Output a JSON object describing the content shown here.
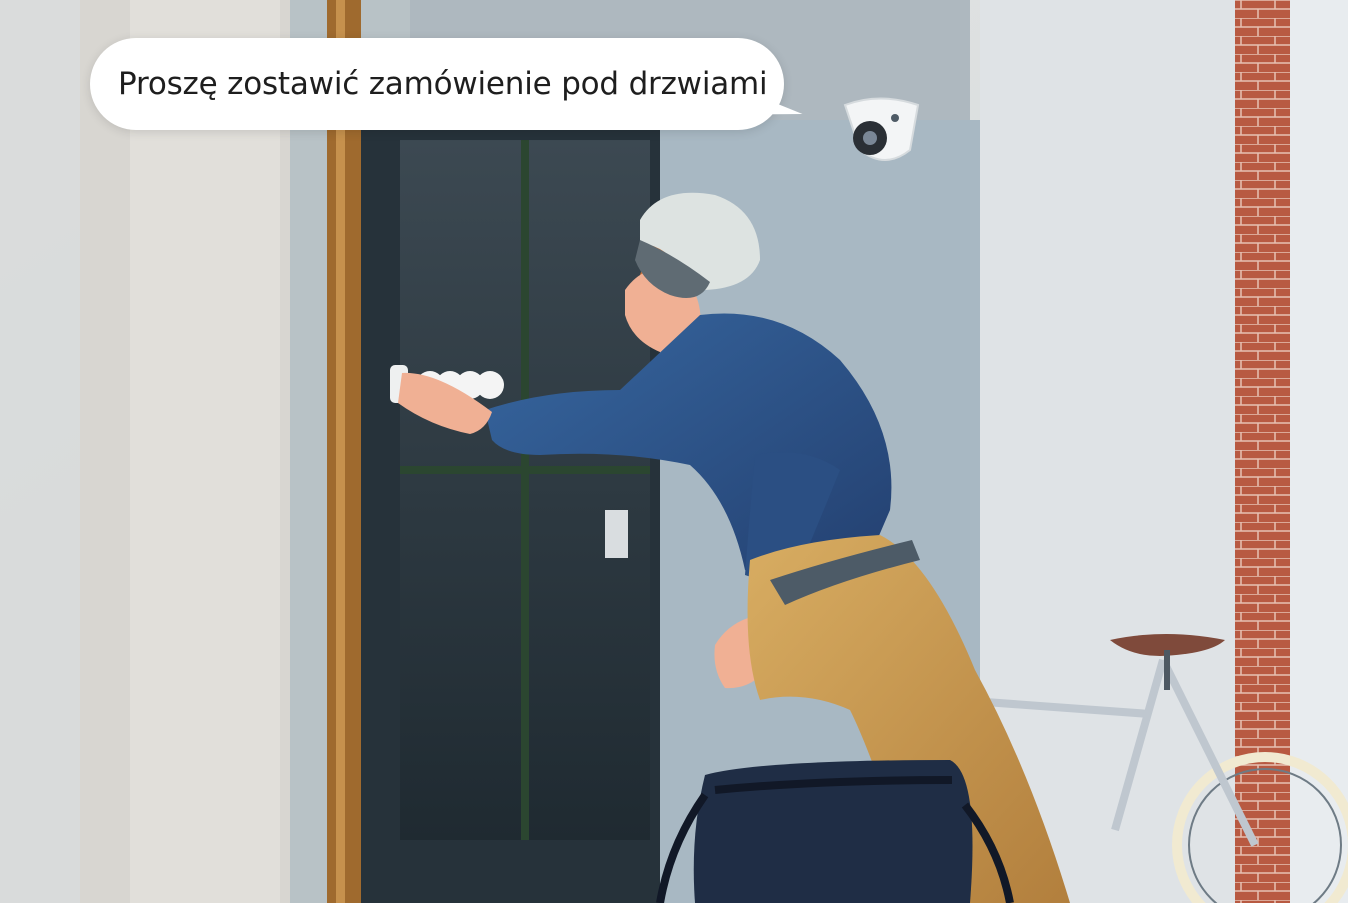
{
  "speech_bubble": {
    "text": "Proszę zostawić zamówienie pod drzwiami"
  },
  "scene": {
    "subject": "courier-with-bicycle-at-door",
    "icons": [
      "dome-security-camera",
      "bicycle",
      "delivery-bag",
      "door-keypad"
    ],
    "colors": {
      "sky_wall": "#d8dee3",
      "door_glass": "#2d3942",
      "brick": "#b85a42",
      "jacket": "#2e5489",
      "pants": "#c99a52",
      "helmet": "#dde3e1"
    }
  }
}
